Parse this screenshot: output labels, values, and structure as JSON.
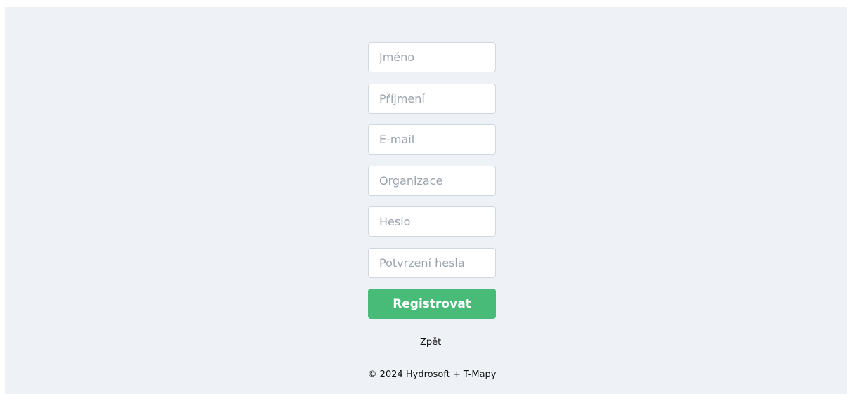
{
  "form": {
    "first_name": {
      "placeholder": "Jméno",
      "value": ""
    },
    "last_name": {
      "placeholder": "Příjmení",
      "value": ""
    },
    "email": {
      "placeholder": "E-mail",
      "value": ""
    },
    "organization": {
      "placeholder": "Organizace",
      "value": ""
    },
    "password": {
      "placeholder": "Heslo",
      "value": ""
    },
    "password_confirm": {
      "placeholder": "Potvrzení hesla",
      "value": ""
    },
    "submit_label": "Registrovat"
  },
  "back_link": "Zpět",
  "footer": {
    "copyright": "© 2024 Hydrosoft + T-Mapy"
  },
  "colors": {
    "page_background": "#eef2f6",
    "button_background": "#48bb78",
    "button_text": "#ffffff",
    "input_border": "#cfd7e0",
    "placeholder_text": "#9aa3ad"
  }
}
